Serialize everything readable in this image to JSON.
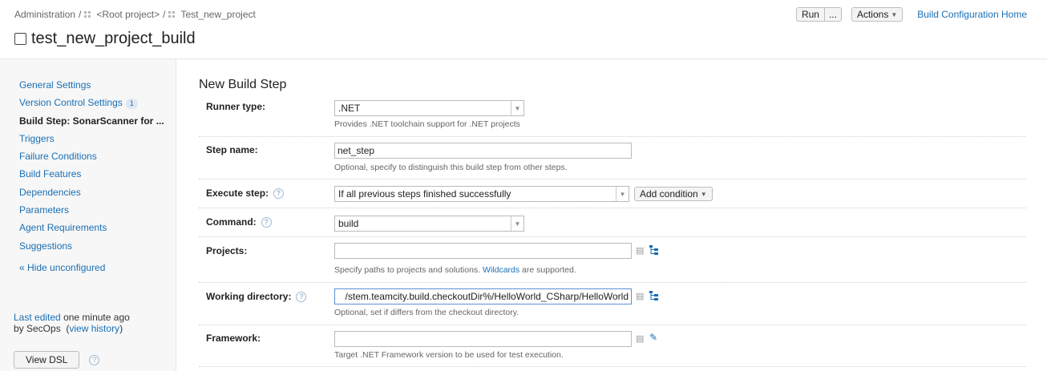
{
  "breadcrumb": {
    "admin": "Administration",
    "separator": "/",
    "root": "<Root project>",
    "project": "Test_new_project"
  },
  "page_title": "test_new_project_build",
  "top_actions": {
    "run_label": "Run",
    "run_more_label": "...",
    "actions_label": "Actions",
    "home_link": "Build Configuration Home"
  },
  "sidebar": {
    "items": [
      {
        "label": "General Settings"
      },
      {
        "label": "Version Control Settings",
        "badge": "1"
      },
      {
        "label": "Build Step: SonarScanner for ..."
      },
      {
        "label": "Triggers"
      },
      {
        "label": "Failure Conditions"
      },
      {
        "label": "Build Features"
      },
      {
        "label": "Dependencies"
      },
      {
        "label": "Parameters"
      },
      {
        "label": "Agent Requirements"
      },
      {
        "label": "Suggestions"
      }
    ],
    "hide_unconfigured": "« Hide unconfigured",
    "last_edited_prefix": "Last edited",
    "last_edited_time": "one minute ago",
    "last_edited_by": "by SecOps",
    "view_history": "view history",
    "view_dsl": "View DSL"
  },
  "form": {
    "section_title": "New Build Step",
    "runner_type": {
      "label": "Runner type:",
      "value": ".NET",
      "hint": "Provides .NET toolchain support for .NET projects"
    },
    "step_name": {
      "label": "Step name:",
      "value": "net_step",
      "hint": "Optional, specify to distinguish this build step from other steps."
    },
    "execute_step": {
      "label": "Execute step:",
      "value": "If all previous steps finished successfully",
      "add_condition": "Add condition"
    },
    "command": {
      "label": "Command:",
      "value": "build"
    },
    "projects": {
      "label": "Projects:",
      "value": "",
      "hint_prefix": "Specify paths to projects and solutions.",
      "hint_link": "Wildcards",
      "hint_suffix": "are supported."
    },
    "working_directory": {
      "label": "Working directory:",
      "value": "/stem.teamcity.build.checkoutDir%/HelloWorld_CSharp/HelloWorld",
      "hint": "Optional, set if differs from the checkout directory."
    },
    "framework": {
      "label": "Framework:",
      "value": "",
      "hint": "Target .NET Framework version to be used for test execution."
    }
  },
  "colors": {
    "link": "#1a6fb4",
    "sidebar_bg": "#f7f7f7"
  }
}
